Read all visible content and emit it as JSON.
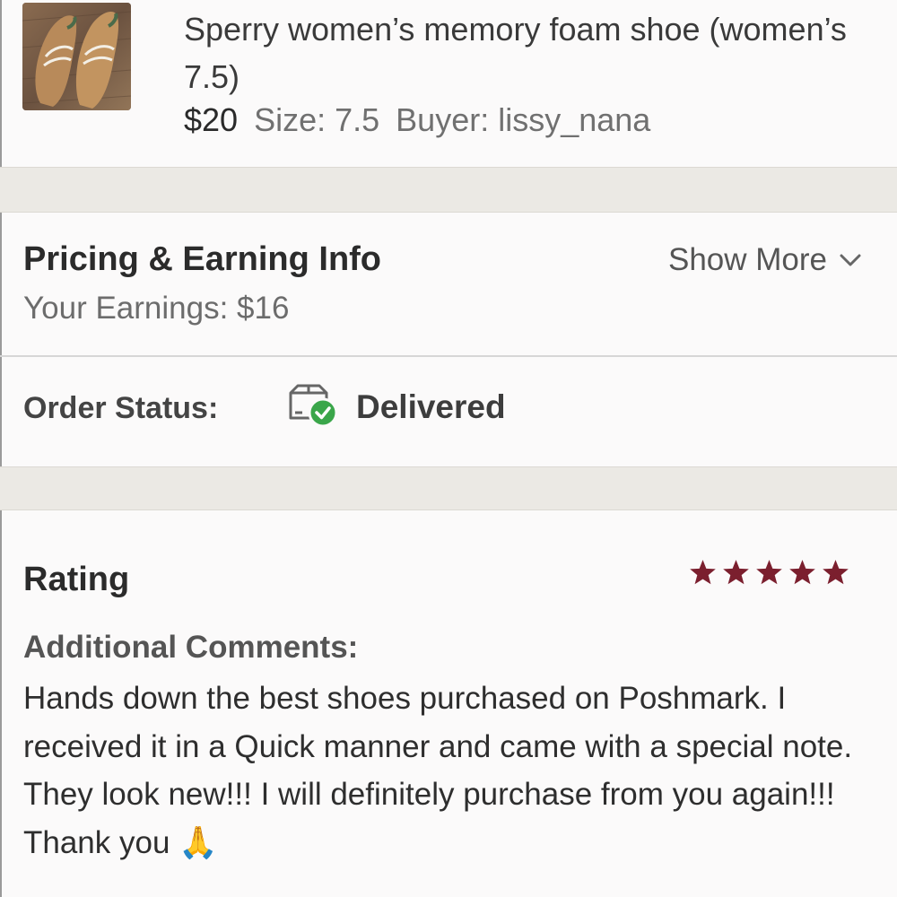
{
  "product": {
    "title": "Sperry women’s memory foam shoe (women’s 7.5)",
    "price": "$20",
    "size": "Size: 7.5",
    "buyer": "Buyer: lissy_nana",
    "thumbnail_icon": "shoe-photo"
  },
  "pricing": {
    "heading": "Pricing & Earning Info",
    "earnings": "Your Earnings: $16",
    "show_more_label": "Show More",
    "show_more_icon": "chevron-down-icon"
  },
  "order_status": {
    "label": "Order Status:",
    "value": "Delivered",
    "icon": "package-delivered-icon",
    "icon_check_color": "#3aa64a"
  },
  "rating": {
    "heading": "Rating",
    "stars": 5,
    "max_stars": 5,
    "star_color": "#7b1f2e",
    "comments_heading": "Additional Comments:",
    "comment": "Hands down the best shoes purchased on Poshmark. I received it in a Quick manner and came with a special note. They look new!!! I will definitely purchase from you again!!! Thank you 🙏"
  },
  "colors": {
    "background": "#fbfafa",
    "section_gap": "#ebe9e4"
  }
}
